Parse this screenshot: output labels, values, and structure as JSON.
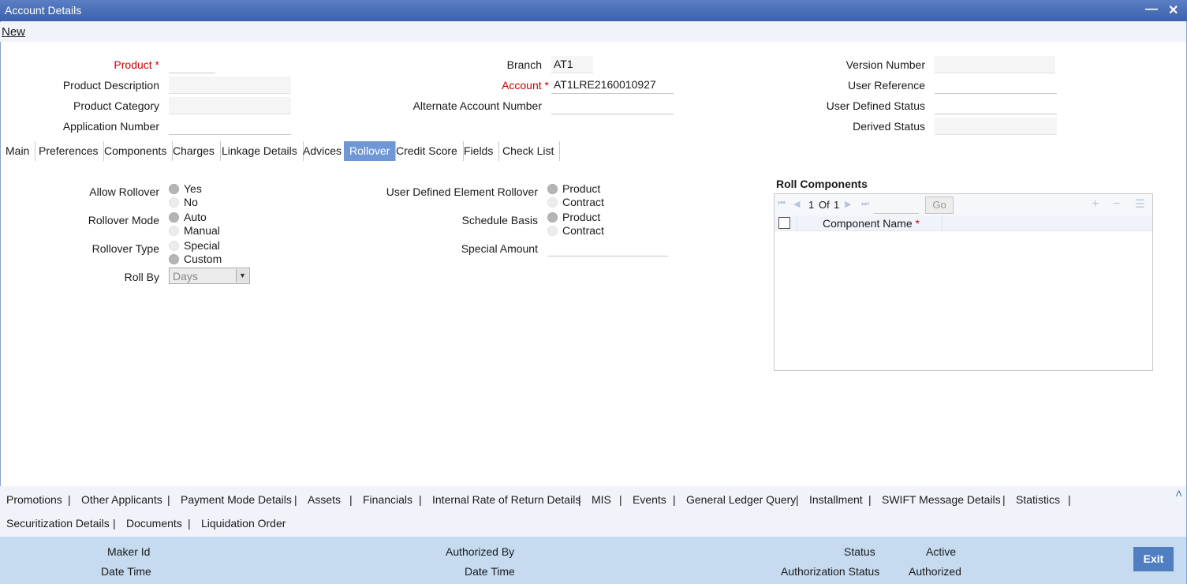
{
  "window": {
    "title": "Account Details",
    "minimize_glyph": "—",
    "close_glyph": "✕"
  },
  "toolbar": {
    "new_label": "New"
  },
  "header": {
    "product_label": "Product",
    "required_mark": "*",
    "product_value": "",
    "product_description_label": "Product Description",
    "product_category_label": "Product Category",
    "application_number_label": "Application Number",
    "branch_label": "Branch",
    "branch_value": "AT1",
    "account_label": "Account",
    "account_value": "AT1LRE2160010927",
    "alternate_account_label": "Alternate Account Number",
    "version_number_label": "Version Number",
    "user_reference_label": "User Reference",
    "user_defined_status_label": "User Defined Status",
    "derived_status_label": "Derived Status"
  },
  "tabs": [
    "Main",
    "Preferences",
    "Components",
    "Charges",
    "Linkage Details",
    "Advices",
    "Rollover",
    "Credit Score",
    "Fields",
    "Check List"
  ],
  "active_tab": "Rollover",
  "rollover": {
    "allow_rollover_label": "Allow Rollover",
    "allow_yes": "Yes",
    "allow_no": "No",
    "rollover_mode_label": "Rollover Mode",
    "mode_auto": "Auto",
    "mode_manual": "Manual",
    "rollover_type_label": "Rollover Type",
    "type_special": "Special",
    "type_custom": "Custom",
    "roll_by_label": "Roll By",
    "roll_by_value": "Days",
    "ude_rollover_label": "User Defined Element Rollover",
    "ude_product": "Product",
    "ude_contract": "Contract",
    "schedule_basis_label": "Schedule Basis",
    "sched_product": "Product",
    "sched_contract": "Contract",
    "special_amount_label": "Special Amount"
  },
  "roll_components": {
    "title": "Roll Components",
    "page_current": "1",
    "page_of": "Of",
    "page_total": "1",
    "go_label": "Go",
    "column_component_name": "Component Name",
    "nav_first": "⏮",
    "nav_prev": "◀",
    "nav_next": "▶",
    "nav_last": "⏭",
    "add_glyph": "+",
    "remove_glyph": "−",
    "list_glyph": "☰"
  },
  "subsystems": {
    "row1": [
      "Promotions",
      "Other Applicants",
      "Payment Mode Details",
      "Assets",
      "Financials",
      "Internal Rate of Return Details",
      "MIS",
      "Events",
      "General Ledger Query",
      "Installment",
      "SWIFT Message Details",
      "Statistics"
    ],
    "row2": [
      "Securitization Details",
      "Documents",
      "Liquidation Order"
    ],
    "separator": "|",
    "collapse_glyph": "˄"
  },
  "footer": {
    "maker_id_label": "Maker Id",
    "date_time_label": "Date Time",
    "authorized_by_label": "Authorized By",
    "checker_date_time_label": "Date Time",
    "status_label": "Status",
    "status_value": "Active",
    "authorization_status_label": "Authorization Status",
    "authorization_status_value": "Authorized",
    "exit_label": "Exit"
  }
}
